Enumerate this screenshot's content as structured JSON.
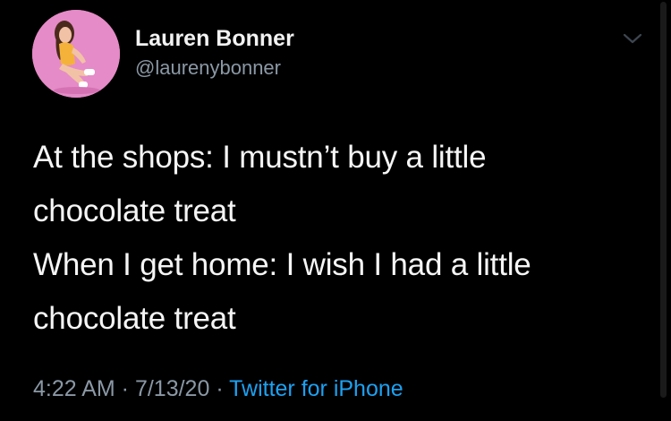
{
  "tweet": {
    "author": {
      "display_name": "Lauren Bonner",
      "handle": "@laurenybonner",
      "avatar": "profile-photo"
    },
    "text_lines": [
      "At the shops: I mustn’t buy a little",
      "chocolate treat",
      "When I get home: I wish I had a little",
      "chocolate treat"
    ],
    "meta": {
      "time": "4:22 AM",
      "separator": " · ",
      "date": "7/13/20",
      "source": "Twitter for iPhone"
    },
    "menu_icon": "chevron-down-icon"
  },
  "colors": {
    "background": "#000000",
    "text": "#f5f5f5",
    "muted": "#8b98a5",
    "link": "#1da1f2",
    "avatar_background": "#e58bc7"
  }
}
